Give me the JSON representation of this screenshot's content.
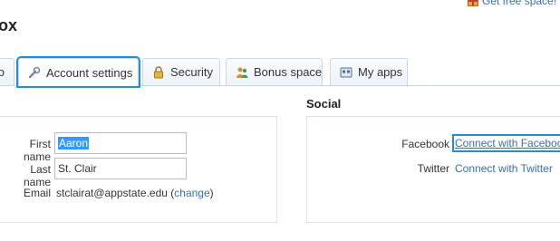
{
  "header": {
    "free_space_label": "Get free space!",
    "app_title": "ox"
  },
  "tabs": [
    {
      "label": "o",
      "icon": "partial-icon",
      "active": false
    },
    {
      "label": "Account settings",
      "icon": "wrench-icon",
      "active": true
    },
    {
      "label": "Security",
      "icon": "lock-icon",
      "active": false
    },
    {
      "label": "Bonus space",
      "icon": "people-icon",
      "active": false
    },
    {
      "label": "My apps",
      "icon": "apps-icon",
      "active": false
    }
  ],
  "profile": {
    "first_name_label": "First name",
    "first_name_value": "Aaron",
    "last_name_label": "Last name",
    "last_name_value": "St. Clair",
    "email_label": "Email",
    "email_value": "stclairat@appstate.edu",
    "email_open_paren": "(",
    "change_link": "change",
    "email_close_paren": ")"
  },
  "social": {
    "heading": "Social",
    "facebook_label": "Facebook",
    "facebook_link": "Connect with Facebook",
    "twitter_label": "Twitter",
    "twitter_link": "Connect with Twitter"
  },
  "colors": {
    "link": "#3a6fb0",
    "focus_outline": "#1e8fe0",
    "selection": "#3399ff"
  }
}
